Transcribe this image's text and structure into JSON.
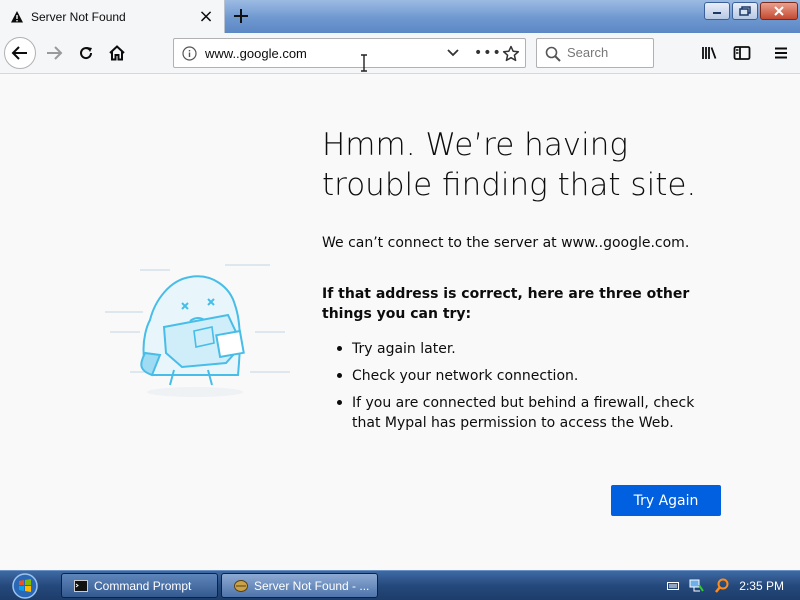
{
  "browser": {
    "tab": {
      "title": "Server Not Found",
      "icon": "warning-icon"
    },
    "new_tab_icon": "plus-icon",
    "url": "www..google.com",
    "search_placeholder": "Search"
  },
  "page": {
    "headline": "Hmm. We’re having trouble finding that site.",
    "description": "We can’t connect to the server at www..google.com.",
    "lead": "If that address is correct, here are three other things you can try:",
    "tips": [
      "Try again later.",
      "Check your network connection.",
      "If you are connected but behind a firewall, check that Mypal has permission to access the Web."
    ],
    "button_label": "Try Again"
  },
  "taskbar": {
    "tasks": [
      {
        "label": "Command Prompt",
        "icon": "command-prompt-icon"
      },
      {
        "label": "Server Not Found - ...",
        "icon": "browser-icon"
      }
    ],
    "clock": "2:35 PM"
  },
  "colors": {
    "accent": "#0060df",
    "page_bg": "#f9f9fa",
    "text": "#0c0c0d"
  }
}
